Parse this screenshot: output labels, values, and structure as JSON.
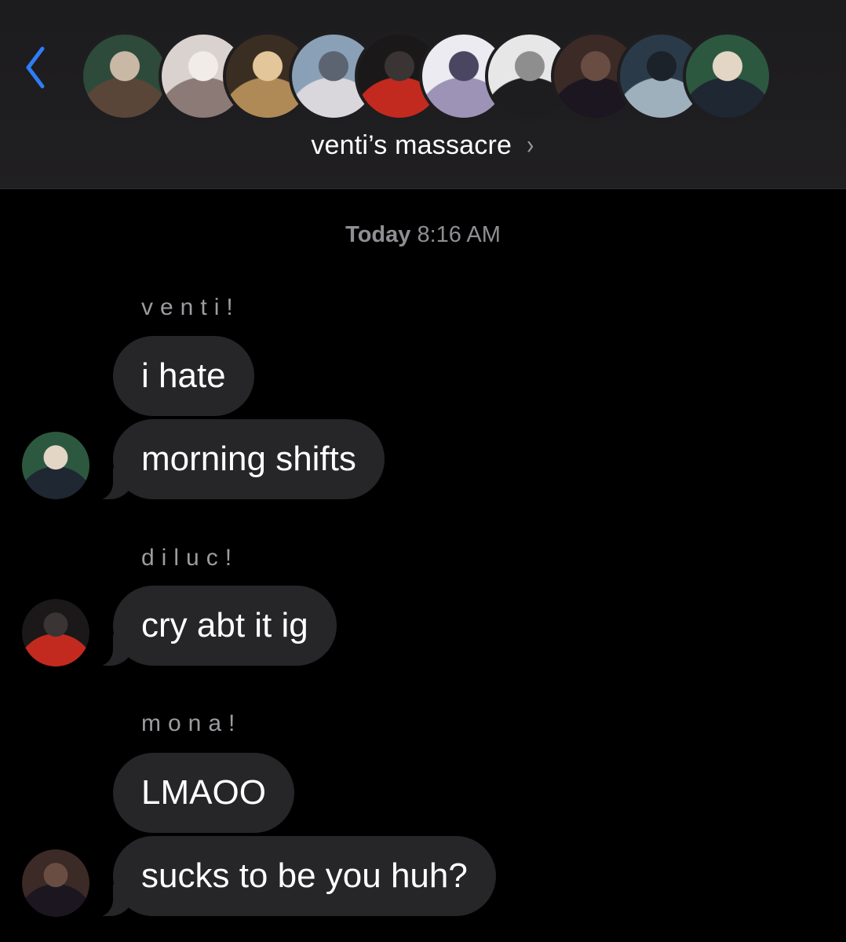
{
  "header": {
    "back_icon": "chevron-left-icon",
    "group_name": "venti’s massacre",
    "group_chevron": "›",
    "accent_color": "#2f7cf6",
    "members": [
      {
        "avatar": "member-avatar-1",
        "colors": [
          "#2e4a3a",
          "#5a4638",
          "#c9b8a6"
        ]
      },
      {
        "avatar": "member-avatar-2",
        "colors": [
          "#d9d2cf",
          "#8c7a76",
          "#f1ece8"
        ]
      },
      {
        "avatar": "member-avatar-3",
        "colors": [
          "#3a2d22",
          "#b08a56",
          "#e3c79a"
        ]
      },
      {
        "avatar": "member-avatar-4",
        "colors": [
          "#8aa0b6",
          "#d9d6dc",
          "#5b6470"
        ]
      },
      {
        "avatar": "member-avatar-5",
        "colors": [
          "#1a1818",
          "#c32a1f",
          "#3a3434"
        ]
      },
      {
        "avatar": "member-avatar-6",
        "colors": [
          "#ecebf1",
          "#9d93b7",
          "#4a4560"
        ]
      },
      {
        "avatar": "member-avatar-7",
        "colors": [
          "#e7e7e7",
          "#1d1d1f",
          "#8e8e8e"
        ]
      },
      {
        "avatar": "member-avatar-8",
        "colors": [
          "#3b2a25",
          "#1c1620",
          "#6a4d42"
        ]
      },
      {
        "avatar": "member-avatar-9",
        "colors": [
          "#2a3a48",
          "#9fb0bd",
          "#1b222a"
        ]
      },
      {
        "avatar": "member-avatar-10",
        "colors": [
          "#2d5840",
          "#1f2733",
          "#e3d6c5"
        ]
      }
    ]
  },
  "conversation": {
    "timestamp_day": "Today",
    "timestamp_time": "8:16 AM",
    "groups": [
      {
        "sender": "venti!",
        "messages": [
          "i hate",
          "morning shifts"
        ],
        "avatar_colors": [
          "#2d5840",
          "#1f2733",
          "#e3d6c5"
        ]
      },
      {
        "sender": "diluc!",
        "messages": [
          "cry abt it ig"
        ],
        "avatar_colors": [
          "#1a1818",
          "#c32a1f",
          "#3a3434"
        ]
      },
      {
        "sender": "mona!",
        "messages": [
          "LMAOO",
          "sucks to be you huh?"
        ],
        "avatar_colors": [
          "#3b2a25",
          "#1c1620",
          "#6a4d42"
        ]
      }
    ]
  }
}
